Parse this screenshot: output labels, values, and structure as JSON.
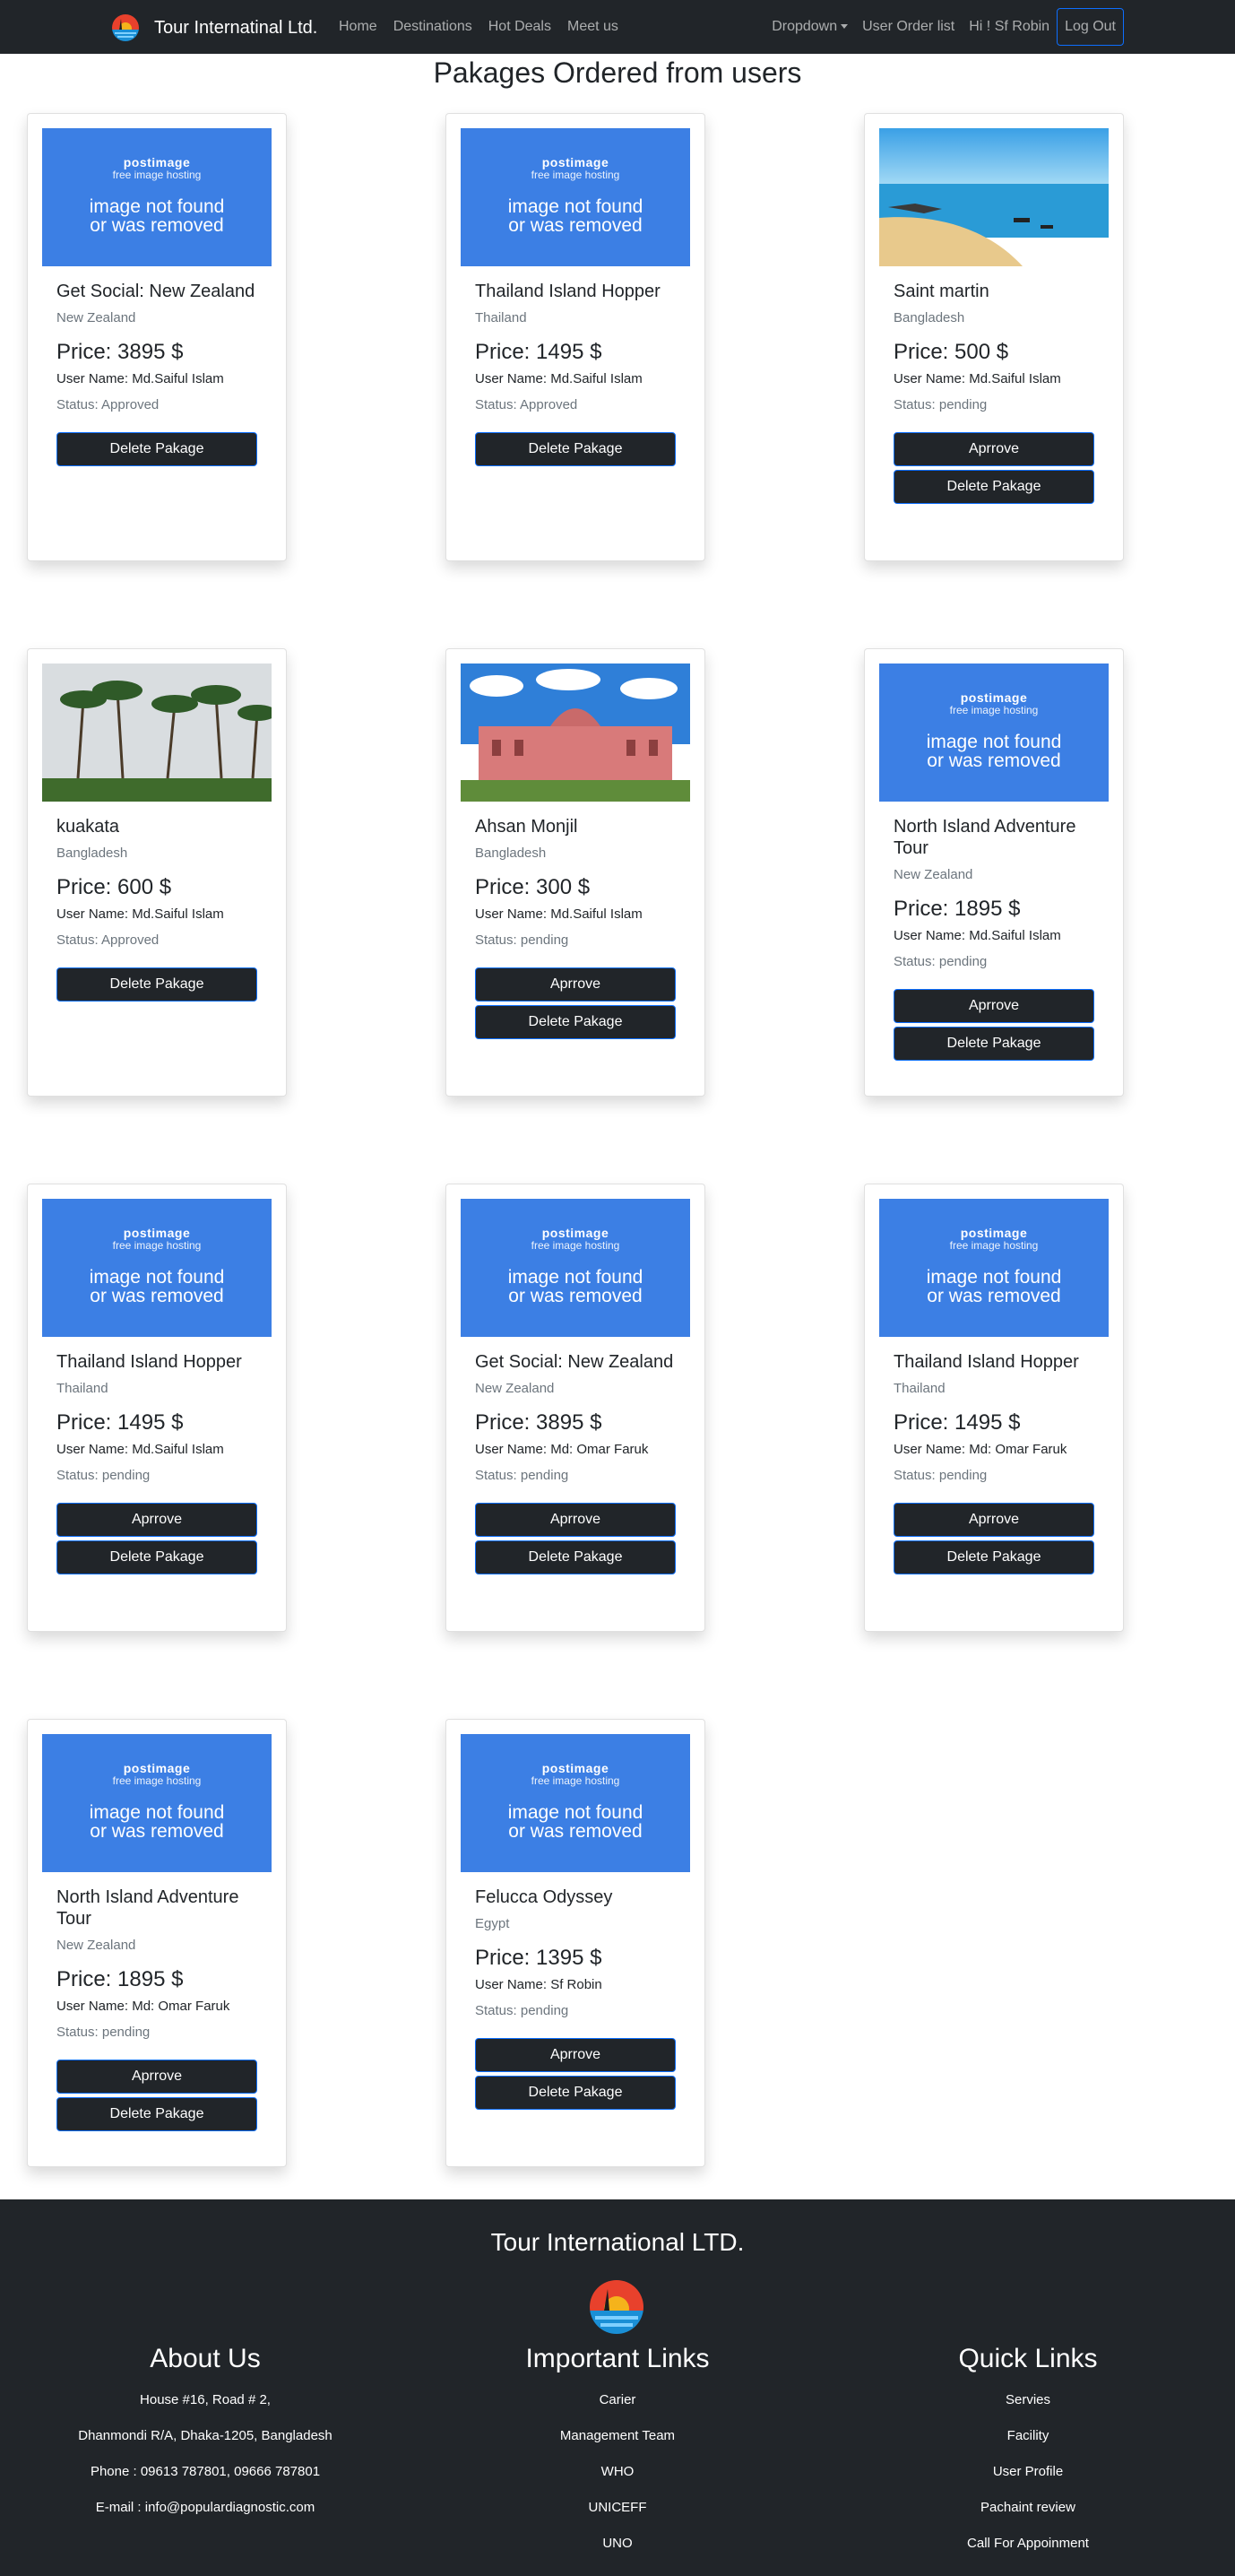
{
  "navbar": {
    "brand": "Tour Internatinal Ltd.",
    "links": [
      "Home",
      "Destinations",
      "Hot Deals",
      "Meet us"
    ],
    "dropdown": "Dropdown",
    "user_order_list": "User Order list",
    "greeting": "Hi ! Sf Robin",
    "logout": "Log Out"
  },
  "page_title": "Pakages Ordered from users",
  "placeholder": {
    "brand": "postimage",
    "sub": "free image hosting",
    "msg1": "image not found",
    "msg2": "or was removed"
  },
  "labels": {
    "price": "Price:",
    "user_name": "User Name:",
    "status": "Status:",
    "approve": "Aprrove",
    "delete": "Delete Pakage"
  },
  "orders": [
    {
      "title": "Get Social: New Zealand",
      "country": "New Zealand",
      "price": "3895 $",
      "user": "Md.Saiful Islam",
      "status": "Approved",
      "image": "placeholder"
    },
    {
      "title": "Thailand Island Hopper",
      "country": "Thailand",
      "price": "1495 $",
      "user": "Md.Saiful Islam",
      "status": "Approved",
      "image": "placeholder"
    },
    {
      "title": "Saint martin",
      "country": "Bangladesh",
      "price": "500 $",
      "user": "Md.Saiful Islam",
      "status": "pending",
      "image": "beach"
    },
    {
      "title": "kuakata",
      "country": "Bangladesh",
      "price": "600 $",
      "user": "Md.Saiful Islam",
      "status": "Approved",
      "image": "palms"
    },
    {
      "title": "Ahsan Monjil",
      "country": "Bangladesh",
      "price": "300 $",
      "user": "Md.Saiful Islam",
      "status": "pending",
      "image": "palace"
    },
    {
      "title": "North Island Adventure Tour",
      "country": "New Zealand",
      "price": "1895 $",
      "user": "Md.Saiful Islam",
      "status": "pending",
      "image": "placeholder"
    },
    {
      "title": "Thailand Island Hopper",
      "country": "Thailand",
      "price": "1495 $",
      "user": "Md.Saiful Islam",
      "status": "pending",
      "image": "placeholder"
    },
    {
      "title": "Get Social: New Zealand",
      "country": "New Zealand",
      "price": "3895 $",
      "user": "Md: Omar Faruk",
      "status": "pending",
      "image": "placeholder"
    },
    {
      "title": "Thailand Island Hopper",
      "country": "Thailand",
      "price": "1495 $",
      "user": "Md: Omar Faruk",
      "status": "pending",
      "image": "placeholder"
    },
    {
      "title": "North Island Adventure Tour",
      "country": "New Zealand",
      "price": "1895 $",
      "user": "Md: Omar Faruk",
      "status": "pending",
      "image": "placeholder"
    },
    {
      "title": "Felucca Odyssey",
      "country": "Egypt",
      "price": "1395 $",
      "user": "Sf Robin",
      "status": "pending",
      "image": "placeholder"
    }
  ],
  "footer": {
    "title": "Tour International LTD.",
    "about": {
      "heading": "About Us",
      "items": [
        "House #16, Road # 2,",
        "Dhanmondi R/A, Dhaka-1205, Bangladesh",
        "Phone : 09613 787801, 09666 787801",
        "E-mail : info@populardiagnostic.com"
      ]
    },
    "important": {
      "heading": "Important Links",
      "items": [
        "Carier",
        "Management Team",
        "WHO",
        "UNICEFF",
        "UNO"
      ]
    },
    "quick": {
      "heading": "Quick Links",
      "items": [
        "Servies",
        "Facility",
        "User Profile",
        "Pachaint review",
        "Call For Appoinment"
      ]
    }
  },
  "colors": {
    "navbar_bg": "#212529",
    "accent": "#0d6efd",
    "placeholder_bg": "#3c7fe4"
  }
}
